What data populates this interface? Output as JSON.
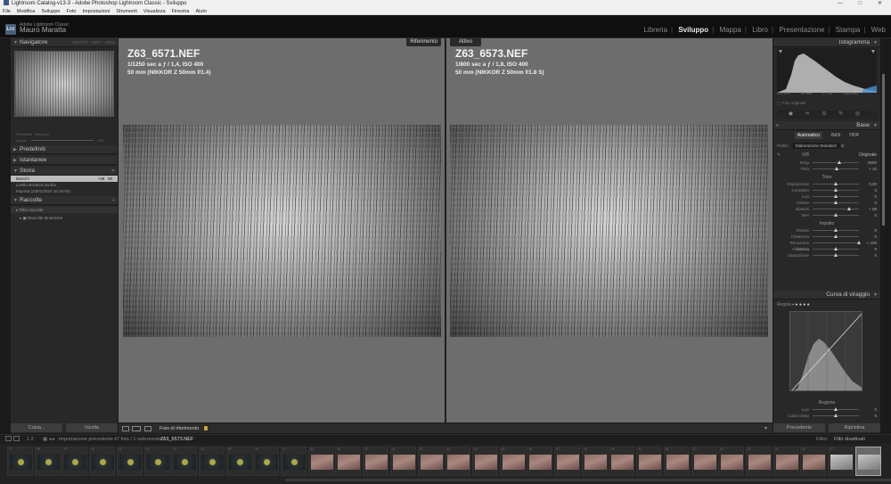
{
  "window": {
    "title": "Lightroom Catalog-v13-3 - Adobe Photoshop Lightroom Classic - Sviluppo",
    "controls": [
      "—",
      "□",
      "✕"
    ]
  },
  "menu": [
    "File",
    "Modifica",
    "Sviluppo",
    "Foto",
    "Impostazioni",
    "Strumenti",
    "Visualizza",
    "Finestra",
    "Aiuto"
  ],
  "identity": {
    "badge": "Lrc",
    "app": "Adobe Lightroom Classic",
    "user": "Mauro Maratta"
  },
  "modules": [
    {
      "label": "Libreria",
      "active": false
    },
    {
      "label": "Sviluppo",
      "active": true
    },
    {
      "label": "Mappa",
      "active": false
    },
    {
      "label": "Libro",
      "active": false
    },
    {
      "label": "Presentazione",
      "active": false
    },
    {
      "label": "Stampa",
      "active": false
    },
    {
      "label": "Web",
      "active": false
    }
  ],
  "left": {
    "navigator": {
      "title": "Navigatore",
      "options": [
        "ADATTA",
        "100%",
        "200%"
      ]
    },
    "preset_hint": [
      "Predefiniti",
      "Nessuno"
    ],
    "quantity": {
      "label": "Quant.",
      "value": "100"
    },
    "panels": [
      {
        "title": "Predefiniti",
        "tri": "▶"
      },
      {
        "title": "Istantanee",
        "tri": "▶"
      },
      {
        "title": "Storia",
        "tri": "▼",
        "right": "✕"
      }
    ],
    "history": [
      {
        "label": "Bianchi",
        "a": "+58",
        "b": "58",
        "selected": true
      },
      {
        "label": "Livello struttura rischia",
        "a": "",
        "b": "",
        "selected": false
      },
      {
        "label": "Importa (23/01/2024 10:16:02)",
        "a": "",
        "b": "",
        "selected": false
      }
    ],
    "collections": {
      "title": "Raccolte",
      "right": "+",
      "items": [
        "Filtro raccolte",
        "Raccolte dinamiche"
      ]
    },
    "buttons": {
      "copy": "Copia...",
      "paste": "Incolla"
    }
  },
  "compare": {
    "left": {
      "tag": "Riferimento",
      "filename": "Z63_6571.NEF",
      "exposure": "1/1250 sec a ƒ / 1,4, ISO 400",
      "lens": "50 mm (NIKKOR Z 50mm f/1.4)"
    },
    "right": {
      "tag": "Attivo",
      "filename": "Z63_6573.NEF",
      "exposure": "1/800 sec a ƒ / 1,8, ISO 400",
      "lens": "50 mm (NIKKOR Z 50mm f/1.8 S)"
    }
  },
  "toolbar": {
    "label": "Foto di riferimento",
    "dropdown": "▾"
  },
  "right": {
    "histogram_title": "Istogramma",
    "hist_info": [
      "ISO 400",
      "50 mm",
      "ƒ / 1,8",
      "1/800 sec"
    ],
    "original_photo": "Foto originale",
    "tools": "◉ ✂ ⊙ ✎ ◎",
    "basic": {
      "title": "Base",
      "treatment": [
        "Automatico",
        "B&N",
        "HDR"
      ],
      "profile_label": "Profilo",
      "profile_value": "Elaborazione Standard",
      "wb_label": "WB",
      "wb_value": "Originale",
      "temp": {
        "label": "Temp",
        "value": "5500"
      },
      "tint": {
        "label": "Tinta",
        "value": "+ 10"
      },
      "tone_title": "Tono",
      "tone": [
        {
          "label": "Esposizione",
          "value": "0,00",
          "pos": 0.5
        },
        {
          "label": "Contrasto",
          "value": "0",
          "pos": 0.5
        },
        {
          "label": "Luci",
          "value": "0",
          "pos": 0.5
        },
        {
          "label": "Ombre",
          "value": "0",
          "pos": 0.5
        },
        {
          "label": "Bianchi",
          "value": "+ 58",
          "pos": 0.79
        },
        {
          "label": "Neri",
          "value": "0",
          "pos": 0.5
        }
      ],
      "presence_title": "Impatto",
      "presence": [
        {
          "label": "Texture",
          "value": "0",
          "pos": 0.5
        },
        {
          "label": "Chiarezza",
          "value": "0",
          "pos": 0.5
        },
        {
          "label": "Rimozione foschia",
          "value": "+ 100",
          "pos": 1.0
        },
        {
          "label": "Vividezza",
          "value": "0",
          "pos": 0.5
        },
        {
          "label": "Saturazione",
          "value": "0",
          "pos": 0.5
        }
      ]
    },
    "curve": {
      "title": "Curva di viraggio",
      "sub": "Regola",
      "region": "Regione",
      "rows": [
        {
          "label": "Luci",
          "value": "0"
        },
        {
          "label": "Colori chiari",
          "value": "0"
        }
      ]
    },
    "buttons": {
      "previous": "Precedente",
      "reset": "Ripristina"
    }
  },
  "filmstrip_bar": {
    "pages": "1  2",
    "source": "Importazione precedente",
    "count": "47 foto / 1 selezionato /",
    "current": "Z63_6573.NEF",
    "filter_label": "Filtro:",
    "filter_value": "Filtri disattivati"
  },
  "filmstrip": {
    "numbers": [
      "27",
      "28",
      "29",
      "30",
      "31",
      "32",
      "33",
      "34",
      "35",
      "36",
      "37",
      "38",
      "39",
      "40",
      "41",
      "42",
      "43",
      "44",
      "45",
      "46",
      "47",
      "48",
      "49",
      "50",
      "51",
      "52",
      "53",
      "54",
      "55",
      "56",
      "57",
      "58"
    ],
    "kinds": [
      "dark",
      "dark",
      "dark",
      "dark",
      "dark",
      "dark",
      "dark",
      "dark",
      "dark",
      "dark",
      "dark",
      "warm",
      "warm",
      "warm",
      "warm",
      "warm",
      "warm",
      "warm",
      "warm",
      "warm",
      "warm",
      "warm",
      "warm",
      "warm",
      "warm",
      "warm",
      "warm",
      "warm",
      "warm",
      "warm",
      "light",
      "light"
    ],
    "selected_index": 31
  },
  "colors": {
    "accent": "#c9a63c",
    "panel": "#282828",
    "center": "#6d6d6d"
  }
}
